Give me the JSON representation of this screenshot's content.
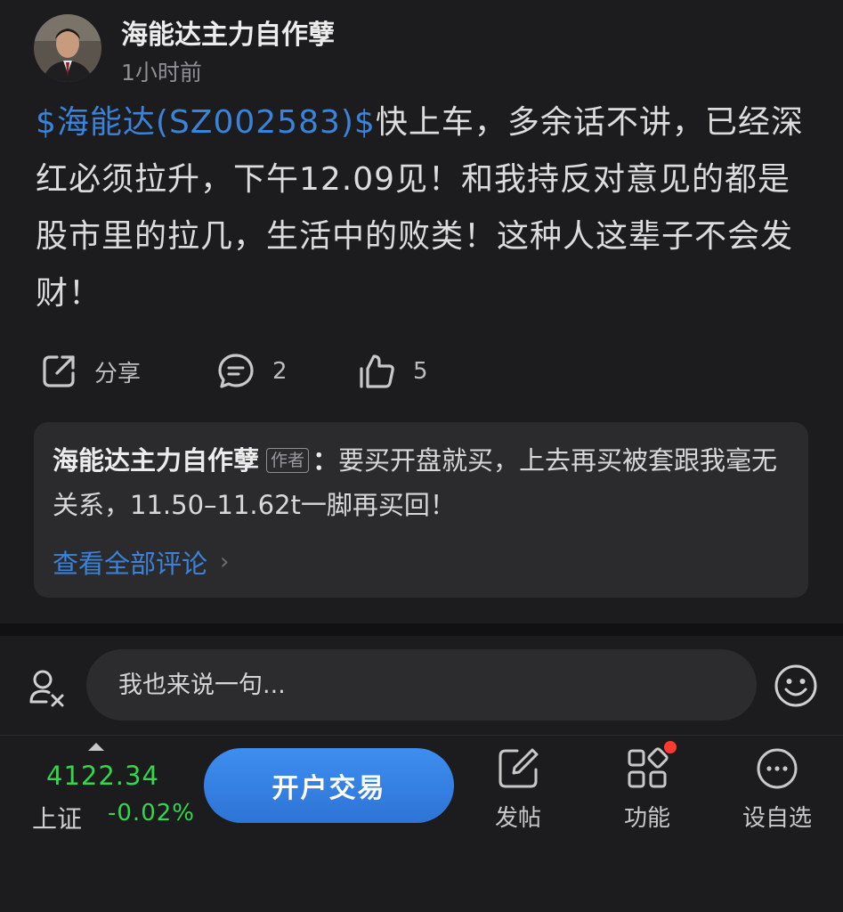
{
  "post": {
    "author_name": "海能达主力自作孽",
    "time": "1小时前",
    "stock_tag": "$海能达(SZ002583)$",
    "body": "快上车，多余话不讲，已经深红必须拉升，下午12.09见！和我持反对意见的都是股市里的拉几，生活中的败类！这种人这辈子不会发财！"
  },
  "actions": {
    "share_label": "分享",
    "comment_count": "2",
    "like_count": "5",
    "icons": [
      "share-icon",
      "comment-icon",
      "like-icon"
    ]
  },
  "comment_preview": {
    "author": "海能达主力自作孽",
    "author_badge": "作者",
    "colon": "：",
    "text": "要买开盘就买，上去再买被套跟我毫无关系，11.50–11.62t一脚再买回！",
    "view_all": "查看全部评论",
    "chevron": "›"
  },
  "reply_bar": {
    "placeholder": "我也来说一句..."
  },
  "bottom_bar": {
    "index_value": "4122.34",
    "index_name": "上证",
    "index_change": "-0.02%",
    "trade_button": "开户交易",
    "tools": [
      {
        "label": "发帖",
        "icon": "edit-icon"
      },
      {
        "label": "功能",
        "icon": "grid-icon",
        "badge": true
      },
      {
        "label": "设自选",
        "icon": "more-icon"
      }
    ]
  },
  "colors": {
    "background": "#1c1c1e",
    "link": "#3b82d9",
    "up_green": "#32d74b",
    "button_blue": "#3a88ea",
    "badge_red": "#ff3b30"
  }
}
